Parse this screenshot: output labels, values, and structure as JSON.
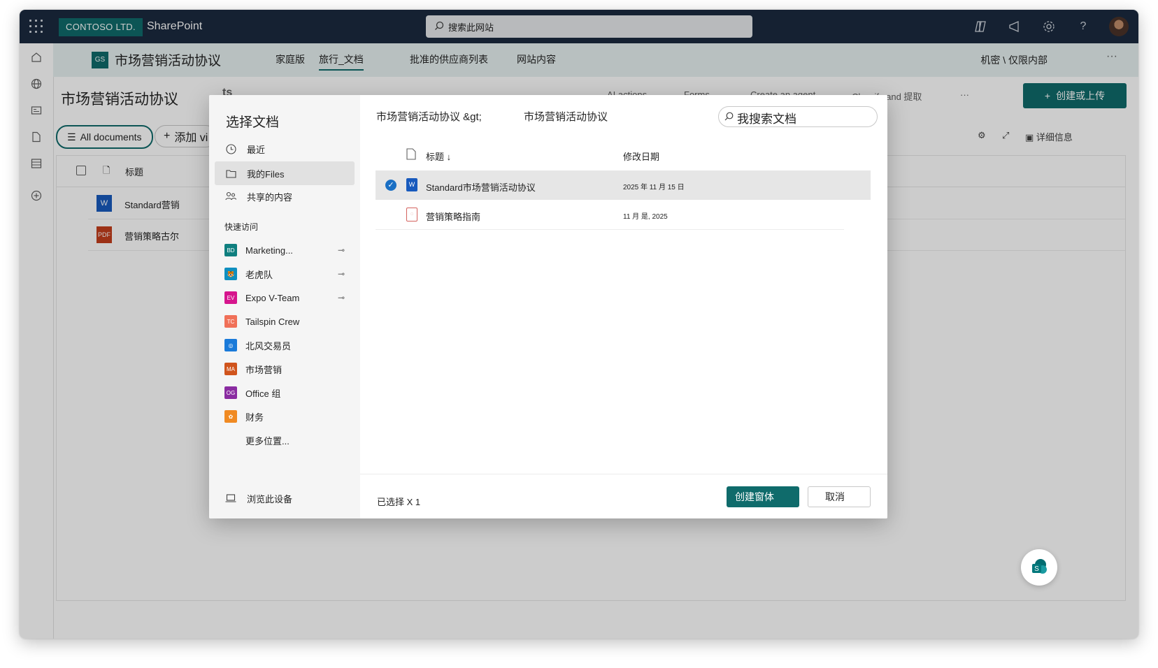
{
  "topbar": {
    "org": "CONTOSO LTD.",
    "product": "SharePoint",
    "search_placeholder": "搜索此网站"
  },
  "site": {
    "logo_text": "GS",
    "title": "市场营销活动协议",
    "nav": [
      "家庭版",
      "旅行_文档",
      "批准的供应商列表",
      "网站内容"
    ],
    "classification": "机密 \\ 仅限内部"
  },
  "page": {
    "title": "市场营销活动协议",
    "hidden_fragment": "ts",
    "commands": [
      "AI actions",
      "Forms",
      "Create an agent",
      "Classify and 提取"
    ],
    "create_label": "创建或上传",
    "view_label": "All documents",
    "add_view_label": "添加 vi",
    "details_label": "详细信息",
    "list_header": "标题",
    "list_rows": [
      "Standard营销",
      "营销策略古尔"
    ]
  },
  "dialog": {
    "title": "选择文档",
    "nav": {
      "recent": "最近",
      "my_files": "我的Files",
      "shared": "共享的内容"
    },
    "quick_access_label": "快速访问",
    "sites": [
      {
        "badge": "BD",
        "name": "Marketing...",
        "color": "#0f7f7f",
        "pinned": true
      },
      {
        "badge": "🐯",
        "name": "老虎队",
        "color": "#0f8fbf",
        "pinned": true
      },
      {
        "badge": "EV",
        "name": "Expo V-Team",
        "color": "#d6158d",
        "pinned": true
      },
      {
        "badge": "TC",
        "name": "Tailspin Crew",
        "color": "#f07058",
        "pinned": false
      },
      {
        "badge": "◎",
        "name": "北风交易员",
        "color": "#1a7ad9",
        "pinned": false
      },
      {
        "badge": "MA",
        "name": "市场营销",
        "color": "#d0541c",
        "pinned": false
      },
      {
        "badge": "OG",
        "name": "Office 组",
        "color": "#8a2ca1",
        "pinned": false
      },
      {
        "badge": "✿",
        "name": "财务",
        "color": "#f08a22",
        "pinned": false
      }
    ],
    "more_locations": "更多位置...",
    "browse_device": "浏览此设备",
    "breadcrumb": [
      "市场营销活动协议 &gt;",
      "市场营销活动协议"
    ],
    "search_placeholder": "我搜索文档",
    "columns": {
      "name": "标题",
      "sort_indicator": "↓",
      "modified": "修改日期"
    },
    "files": [
      {
        "name": "Standard市场营销活动协议",
        "date": "2025 年 11 月 15 日",
        "type": "word",
        "selected": true
      },
      {
        "name": "营销策略指南",
        "date": "11 月 是, 2025",
        "type": "pdf",
        "selected": false
      }
    ],
    "selected_count": "已选择 X 1",
    "primary_button": "创建窗体",
    "cancel_button": "取消"
  },
  "colors": {
    "accent": "#0f6b6b",
    "topbar": "#1b2a3f",
    "sitebar": "#e6f0f0"
  }
}
